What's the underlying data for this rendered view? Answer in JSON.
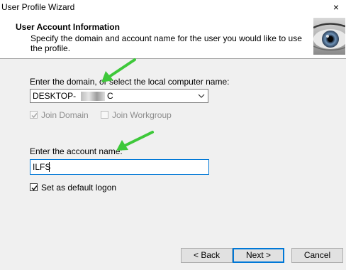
{
  "window": {
    "title": "User Profile Wizard",
    "close_glyph": "×"
  },
  "header": {
    "title": "User Account Information",
    "description": "Specify the domain and account name for the user you would like to use the profile."
  },
  "domain": {
    "label": "Enter the domain, or select the local computer name:",
    "value_prefix": "DESKTOP-",
    "value_suffix": "C",
    "dropdown_icon": "chevron-down-icon"
  },
  "options": {
    "join_domain": {
      "label": "Join Domain",
      "checked": true,
      "enabled": false
    },
    "join_workgroup": {
      "label": "Join Workgroup",
      "checked": false,
      "enabled": false
    }
  },
  "account": {
    "label": "Enter the account name:",
    "value": "ILFS"
  },
  "default_logon": {
    "label": "Set as default logon",
    "checked": true
  },
  "buttons": {
    "back": "< Back",
    "next": "Next >",
    "cancel": "Cancel"
  },
  "colors": {
    "focus": "#0078d7",
    "annotation_arrow": "#3ec83a",
    "panel": "#f0f0f0"
  }
}
